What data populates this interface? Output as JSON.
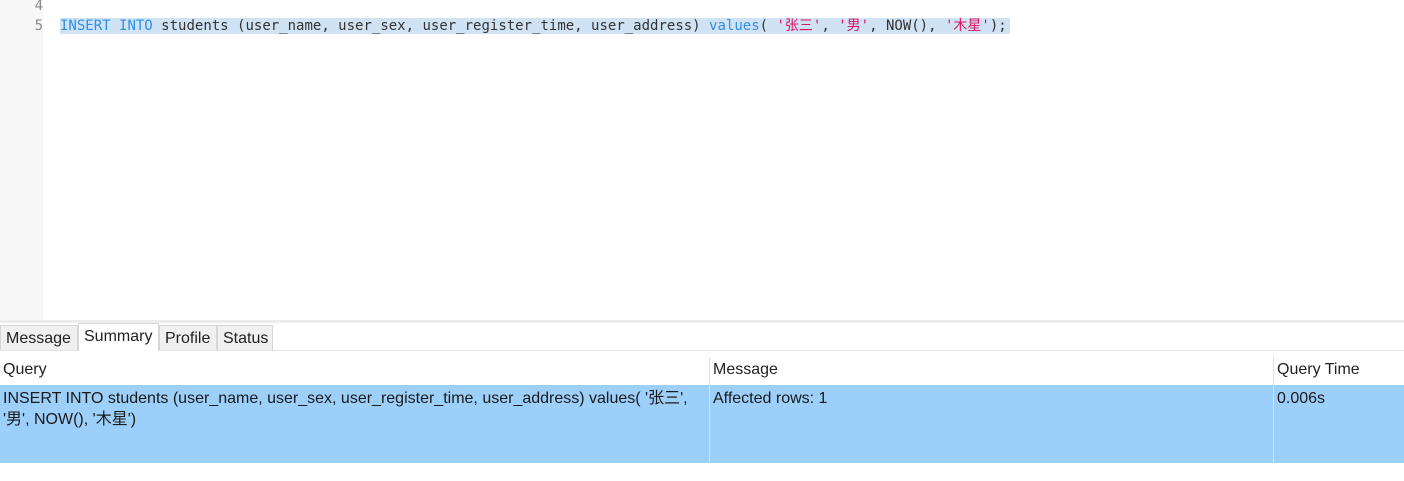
{
  "editor": {
    "line_numbers": [
      "4",
      "5"
    ],
    "code": {
      "kw_insert": "INSERT",
      "kw_into": "INTO",
      "table_part": "students (user_name, user_sex, user_register_time, user_address)",
      "kw_values": "values",
      "open_paren": "(",
      "str1": "'张三'",
      "sep": ",",
      "str2": "'男'",
      "now": "NOW()",
      "str3": "'木星'",
      "close": ");"
    }
  },
  "tabs": [
    {
      "label": "Message"
    },
    {
      "label": "Summary",
      "active": true
    },
    {
      "label": "Profile"
    },
    {
      "label": "Status"
    }
  ],
  "results": {
    "columns": [
      "Query",
      "Message",
      "Query Time"
    ],
    "rows": [
      {
        "query": "INSERT INTO students (user_name, user_sex, user_register_time, user_address) values( '张三', '男', NOW(), '木星')",
        "message": "Affected rows: 1",
        "query_time": "0.006s"
      }
    ]
  },
  "colors": {
    "keyword": "#2f8ee6",
    "string": "#e0115f",
    "selection": "#cfe3f5",
    "selected_row": "#9ccffa"
  }
}
